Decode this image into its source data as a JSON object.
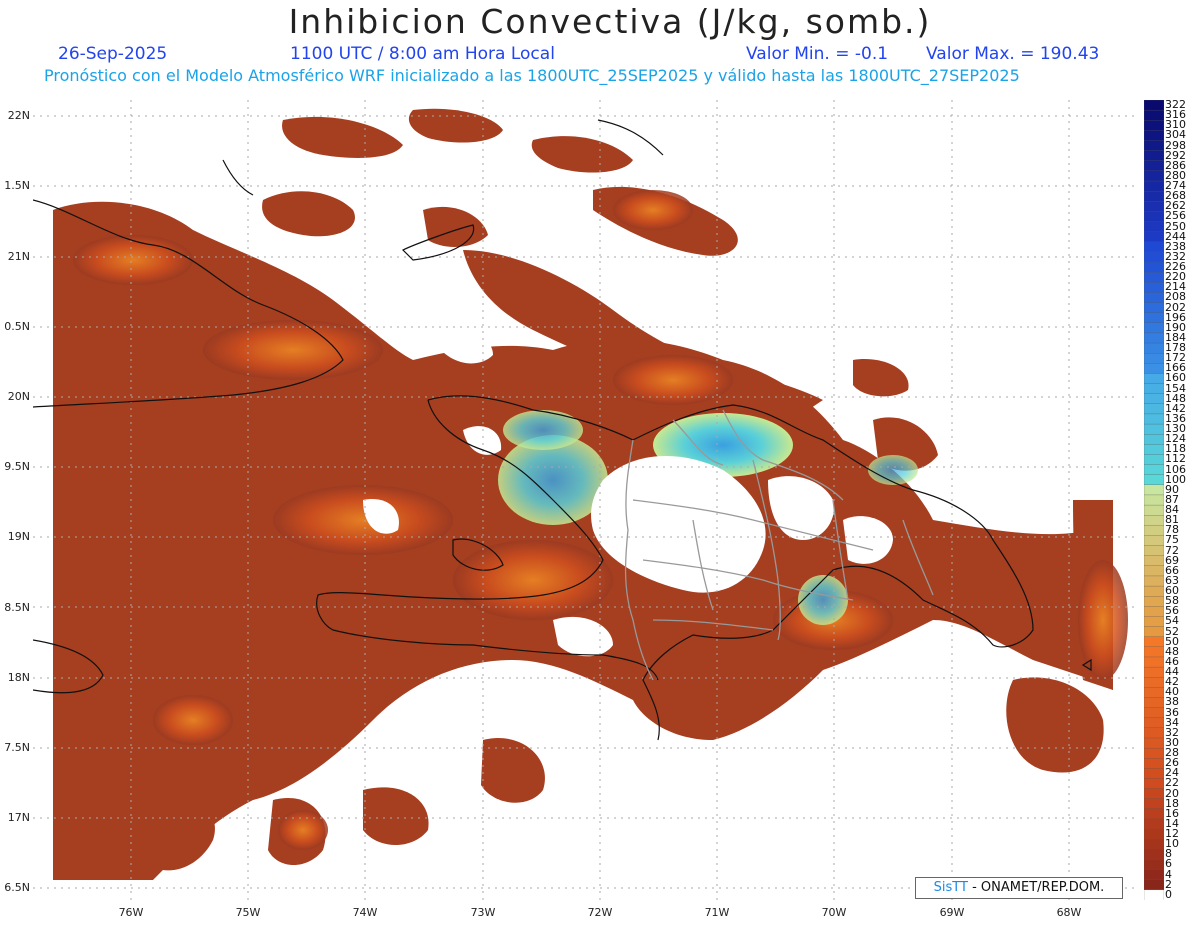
{
  "header": {
    "title": "Inhibicion Convectiva (J/kg, somb.)",
    "date": "26-Sep-2025",
    "time": "1100 UTC / 8:00 am Hora Local",
    "min_label": "Valor Min. = -0.1",
    "max_label": "Valor Max. = 190.43",
    "forecast_note": "Pronóstico con el Modelo Atmosférico WRF inicializado a las 1800UTC_25SEP2025 y válido hasta las  1800UTC_27SEP2025"
  },
  "axes": {
    "lat_labels": [
      "22N",
      "1.5N",
      "21N",
      "0.5N",
      "20N",
      "9.5N",
      "19N",
      "8.5N",
      "18N",
      "7.5N",
      "17N",
      "6.5N"
    ],
    "lon_labels": [
      "76W",
      "75W",
      "74W",
      "73W",
      "72W",
      "71W",
      "70W",
      "69W",
      "68W"
    ]
  },
  "colorbar": {
    "levels": [
      "322",
      "316",
      "310",
      "304",
      "298",
      "292",
      "286",
      "280",
      "274",
      "268",
      "262",
      "256",
      "250",
      "244",
      "238",
      "232",
      "226",
      "220",
      "214",
      "208",
      "202",
      "196",
      "190",
      "184",
      "178",
      "172",
      "166",
      "160",
      "154",
      "148",
      "142",
      "136",
      "130",
      "124",
      "118",
      "112",
      "106",
      "100",
      "90",
      "87",
      "84",
      "81",
      "78",
      "75",
      "72",
      "69",
      "66",
      "63",
      "60",
      "58",
      "56",
      "54",
      "52",
      "50",
      "48",
      "46",
      "44",
      "42",
      "40",
      "38",
      "36",
      "34",
      "32",
      "30",
      "28",
      "26",
      "24",
      "22",
      "20",
      "18",
      "16",
      "14",
      "12",
      "10",
      "8",
      "6",
      "4",
      "2",
      "0"
    ]
  },
  "credit": {
    "logo": "SisTT",
    "text": "- ONAMET/REP.DOM."
  },
  "colors": {
    "low_cin": "#9a3a22",
    "mid_cin": "#e8661c",
    "high_cin": "#5ad0d8",
    "very_high_cin": "#3a8ee0",
    "coast": "#111111",
    "provinces": "#999999"
  }
}
